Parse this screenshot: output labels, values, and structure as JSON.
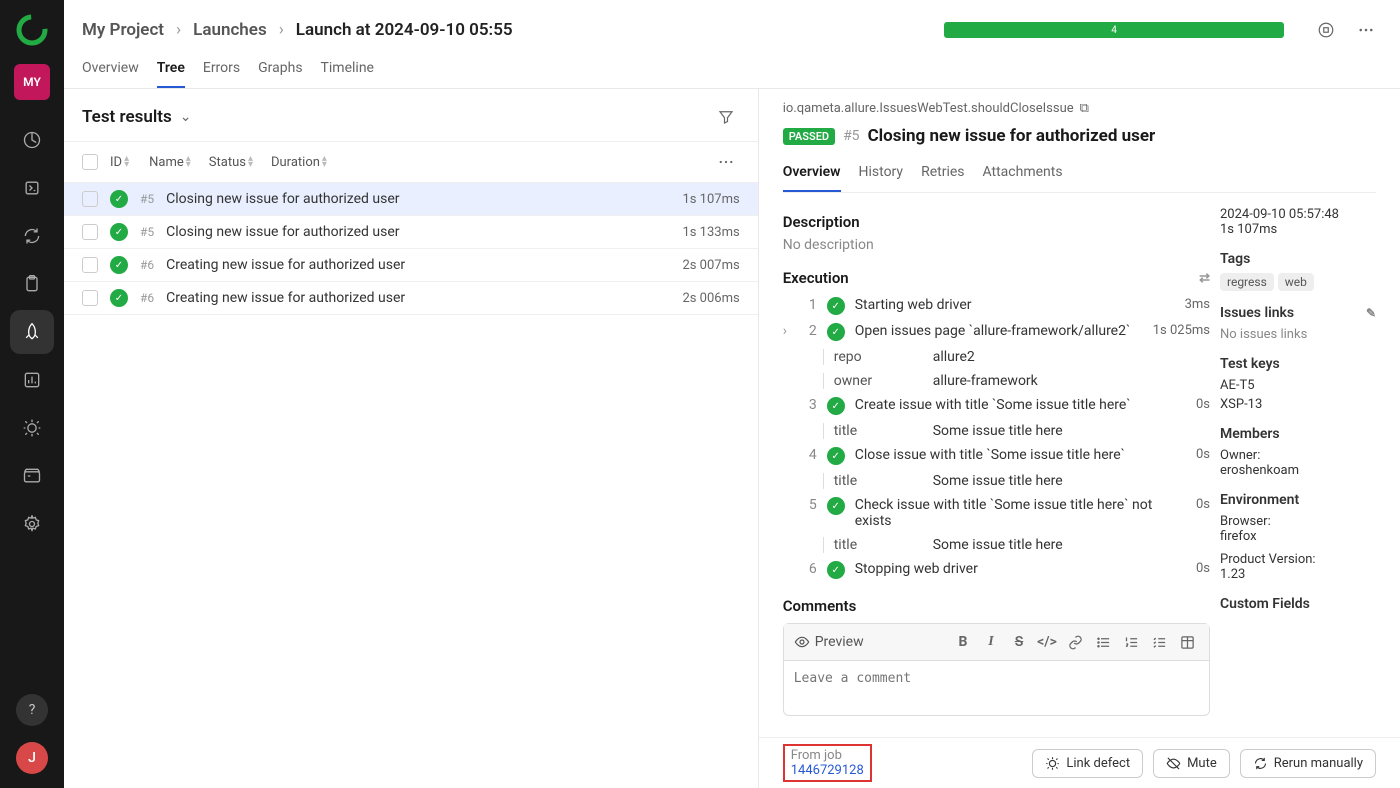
{
  "projectBadge": "MY",
  "userAvatar": "J",
  "helpIcon": "?",
  "breadcrumb": [
    "My Project",
    "Launches",
    "Launch at 2024-09-10 05:55"
  ],
  "progressCount": "4",
  "tabs": [
    "Overview",
    "Tree",
    "Errors",
    "Graphs",
    "Timeline"
  ],
  "activeTab": "Tree",
  "list": {
    "title": "Test results",
    "columns": {
      "id": "ID",
      "name": "Name",
      "status": "Status",
      "duration": "Duration"
    },
    "rows": [
      {
        "id": "#5",
        "name": "Closing new issue for authorized user",
        "duration": "1s 107ms",
        "selected": true
      },
      {
        "id": "#5",
        "name": "Closing new issue for authorized user",
        "duration": "1s 133ms",
        "selected": false
      },
      {
        "id": "#6",
        "name": "Creating new issue for authorized user",
        "duration": "2s 007ms",
        "selected": false
      },
      {
        "id": "#6",
        "name": "Creating new issue for authorized user",
        "duration": "2s 006ms",
        "selected": false
      }
    ]
  },
  "details": {
    "fqn": "io.qameta.allure.IssuesWebTest.shouldCloseIssue",
    "statusBadge": "PASSED",
    "resultId": "#5",
    "title": "Closing new issue for authorized user",
    "tabs": [
      "Overview",
      "History",
      "Retries",
      "Attachments"
    ],
    "activeTab": "Overview",
    "descHeader": "Description",
    "descText": "No description",
    "execHeader": "Execution",
    "steps": [
      {
        "n": "1",
        "name": "Starting web driver",
        "dur": "3ms",
        "expandable": false,
        "params": []
      },
      {
        "n": "2",
        "name": "Open issues page `allure-framework/allure2`",
        "dur": "1s 025ms",
        "expandable": true,
        "params": [
          {
            "k": "repo",
            "v": "allure2"
          },
          {
            "k": "owner",
            "v": "allure-framework"
          }
        ]
      },
      {
        "n": "3",
        "name": "Create issue with title `Some issue title here`",
        "dur": "0s",
        "expandable": false,
        "params": [
          {
            "k": "title",
            "v": "Some issue title here"
          }
        ]
      },
      {
        "n": "4",
        "name": "Close issue with title `Some issue title here`",
        "dur": "0s",
        "expandable": false,
        "params": [
          {
            "k": "title",
            "v": "Some issue title here"
          }
        ]
      },
      {
        "n": "5",
        "name": "Check issue with title `Some issue title here` not exists",
        "dur": "0s",
        "expandable": false,
        "params": [
          {
            "k": "title",
            "v": "Some issue title here"
          }
        ]
      },
      {
        "n": "6",
        "name": "Stopping web driver",
        "dur": "0s",
        "expandable": false,
        "params": []
      }
    ],
    "commentsHeader": "Comments",
    "previewLabel": "Preview",
    "commentPlaceholder": "Leave a comment",
    "meta": {
      "timestamp": "2024-09-10 05:57:48",
      "duration": "1s 107ms",
      "tagsHeader": "Tags",
      "tags": [
        "regress",
        "web"
      ],
      "issuesHeader": "Issues links",
      "issuesText": "No issues links",
      "testKeysHeader": "Test keys",
      "testKeys": [
        "AE-T5",
        "XSP-13"
      ],
      "membersHeader": "Members",
      "ownerLabel": "Owner:",
      "owner": "eroshenkoam",
      "envHeader": "Environment",
      "browserLabel": "Browser:",
      "browser": "firefox",
      "versionLabel": "Product Version:",
      "version": "1.23",
      "customFieldsHeader": "Custom Fields"
    }
  },
  "footer": {
    "jobLabel": "From job",
    "jobId": "1446729128",
    "linkDefect": "Link defect",
    "mute": "Mute",
    "rerun": "Rerun manually"
  }
}
